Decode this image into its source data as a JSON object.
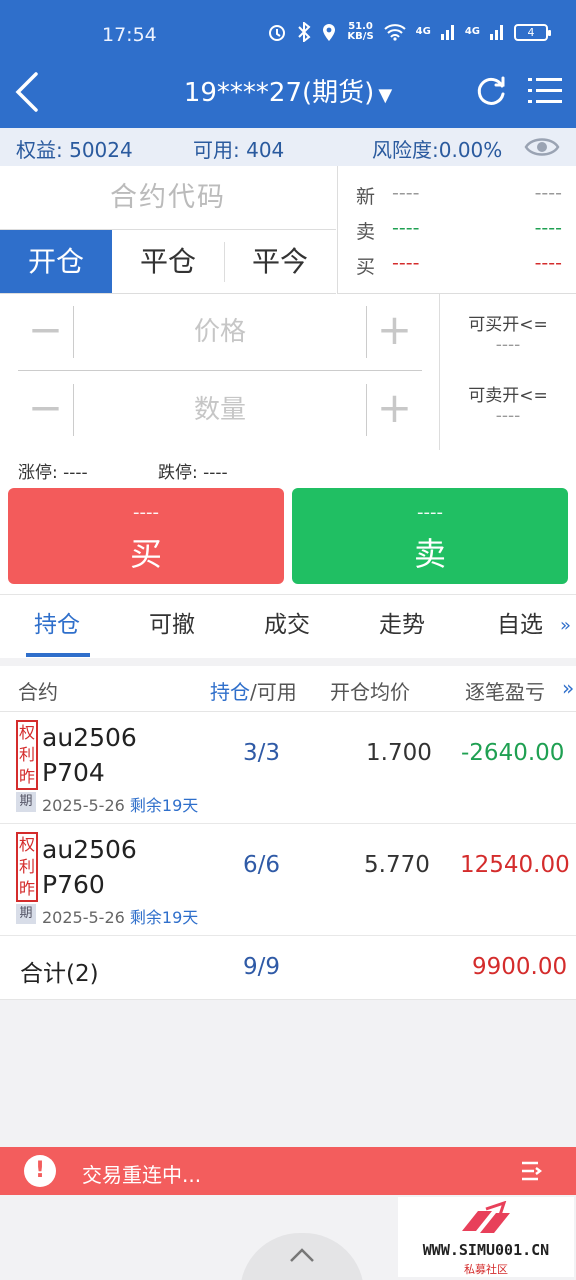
{
  "status": {
    "time": "17:54",
    "net_speed": "51.0",
    "net_unit": "KB/S",
    "battery": "4",
    "signal1": "4G",
    "signal2": "4G"
  },
  "header": {
    "title": "19****27(期货)"
  },
  "account": {
    "equity": "权益: 50024",
    "available": "可用: 404",
    "risk": "风险度:0.00%"
  },
  "order": {
    "code_placeholder": "合约代码",
    "tabs": [
      "开仓",
      "平仓",
      "平今"
    ],
    "quote": {
      "rows": [
        {
          "label": "新",
          "v1": "----",
          "v2": "----"
        },
        {
          "label": "卖",
          "v1": "----",
          "v2": "----"
        },
        {
          "label": "买",
          "v1": "----",
          "v2": "----"
        }
      ]
    },
    "price_placeholder": "价格",
    "qty_placeholder": "数量",
    "minus": "−",
    "plus": "+",
    "can_buy_label": "可买开<=",
    "can_buy_value": "----",
    "can_sell_label": "可卖开<=",
    "can_sell_value": "----"
  },
  "limits": {
    "up": "涨停: ----",
    "down": "跌停: ----"
  },
  "trade": {
    "buy_price": "----",
    "buy_label": "买",
    "sell_price": "----",
    "sell_label": "卖"
  },
  "subtabs": [
    "持仓",
    "可撤",
    "成交",
    "走势",
    "自选"
  ],
  "subtabs_more": "»",
  "table": {
    "headers": {
      "contract": "合约",
      "position": "持仓",
      "available": "/可用",
      "avg_price": "开仓均价",
      "pnl": "逐笔盈亏",
      "more": "»"
    },
    "rows": [
      {
        "tag1": "权",
        "tag2": "利",
        "tag3": "昨",
        "sym1": "au2506",
        "sym2": "P704",
        "qi": "期",
        "expiry": "2025-5-26",
        "remain": "剩余19天",
        "pos": "3/3",
        "price": "1.700",
        "pnl": "-2640.00",
        "pnl_color": "green"
      },
      {
        "tag1": "权",
        "tag2": "利",
        "tag3": "昨",
        "sym1": "au2506",
        "sym2": "P760",
        "qi": "期",
        "expiry": "2025-5-26",
        "remain": "剩余19天",
        "pos": "6/6",
        "price": "5.770",
        "pnl": "12540.00",
        "pnl_color": "red"
      }
    ],
    "total": {
      "label": "合计(2)",
      "pos": "9/9",
      "pnl": "9900.00"
    }
  },
  "banner": {
    "text": "交易重连中..."
  },
  "watermark": {
    "site": "WWW.SIMU001.CN",
    "cn": "私募社区"
  },
  "colors": {
    "primary": "#2f6fcb",
    "buy": "#f35b5b",
    "sell": "#20bf63",
    "loss": "#1fa052",
    "profit": "#d42c2c"
  }
}
